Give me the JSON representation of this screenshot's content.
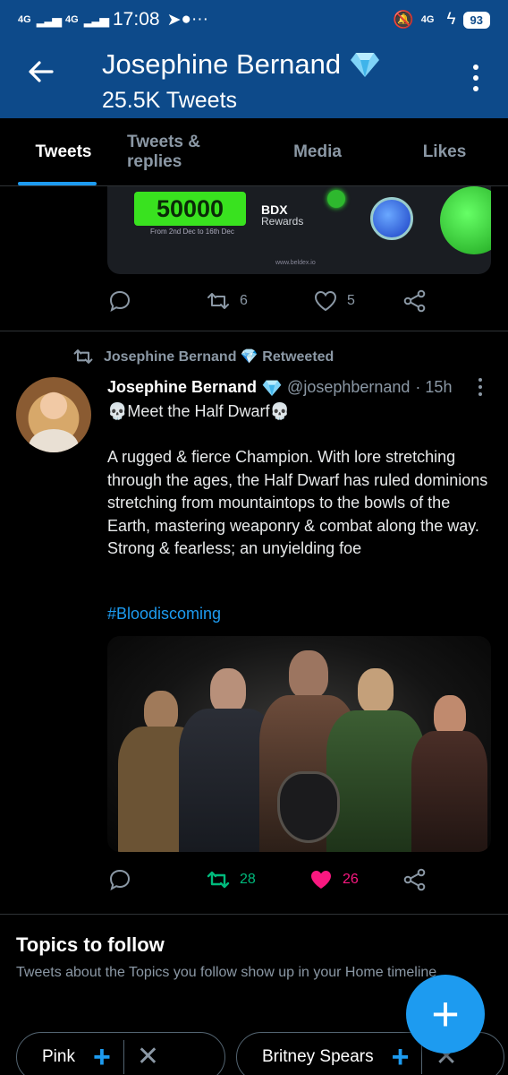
{
  "status_bar": {
    "network1": "4G",
    "network2": "4G",
    "time": "17:08",
    "battery": "93",
    "network_right": "4G"
  },
  "header": {
    "title": "Josephine Bernand",
    "badge_icon": "diamond-emoji",
    "subtitle": "25.5K Tweets"
  },
  "tabs": [
    {
      "label": "Tweets",
      "active": true
    },
    {
      "label": "Tweets & replies",
      "active": false
    },
    {
      "label": "Media",
      "active": false
    },
    {
      "label": "Likes",
      "active": false
    }
  ],
  "tweet1": {
    "promo": {
      "amount": "50000",
      "token": "BDX",
      "rewards": "Rewards",
      "dates": "From 2nd Dec to 16th Dec",
      "url": "www.beldex.io"
    },
    "retweets": "6",
    "likes": "5"
  },
  "tweet2": {
    "retweet_label": "Josephine Bernand 💎 Retweeted",
    "author_name": "Josephine Bernand",
    "author_handle": "@josephbernand",
    "time": "· 15h",
    "headline": "💀Meet the Half Dwarf💀",
    "body": "A rugged & fierce Champion. With lore stretching through the ages, the Half Dwarf has ruled dominions stretching from mountaintops to the bowls of the Earth, mastering weaponry & combat along the way. Strong & fearless; an unyielding foe",
    "hashtag": "#Bloodiscoming",
    "retweets": "28",
    "likes": "26",
    "colors": {
      "retweet_active": "#00ba7c",
      "like_active": "#f91880"
    }
  },
  "topics": {
    "title": "Topics to follow",
    "description": "Tweets about the Topics you follow show up in your Home timeline",
    "chips": [
      {
        "label": "Pink"
      },
      {
        "label": "Britney Spears"
      }
    ]
  },
  "fab": {
    "label": "+"
  }
}
